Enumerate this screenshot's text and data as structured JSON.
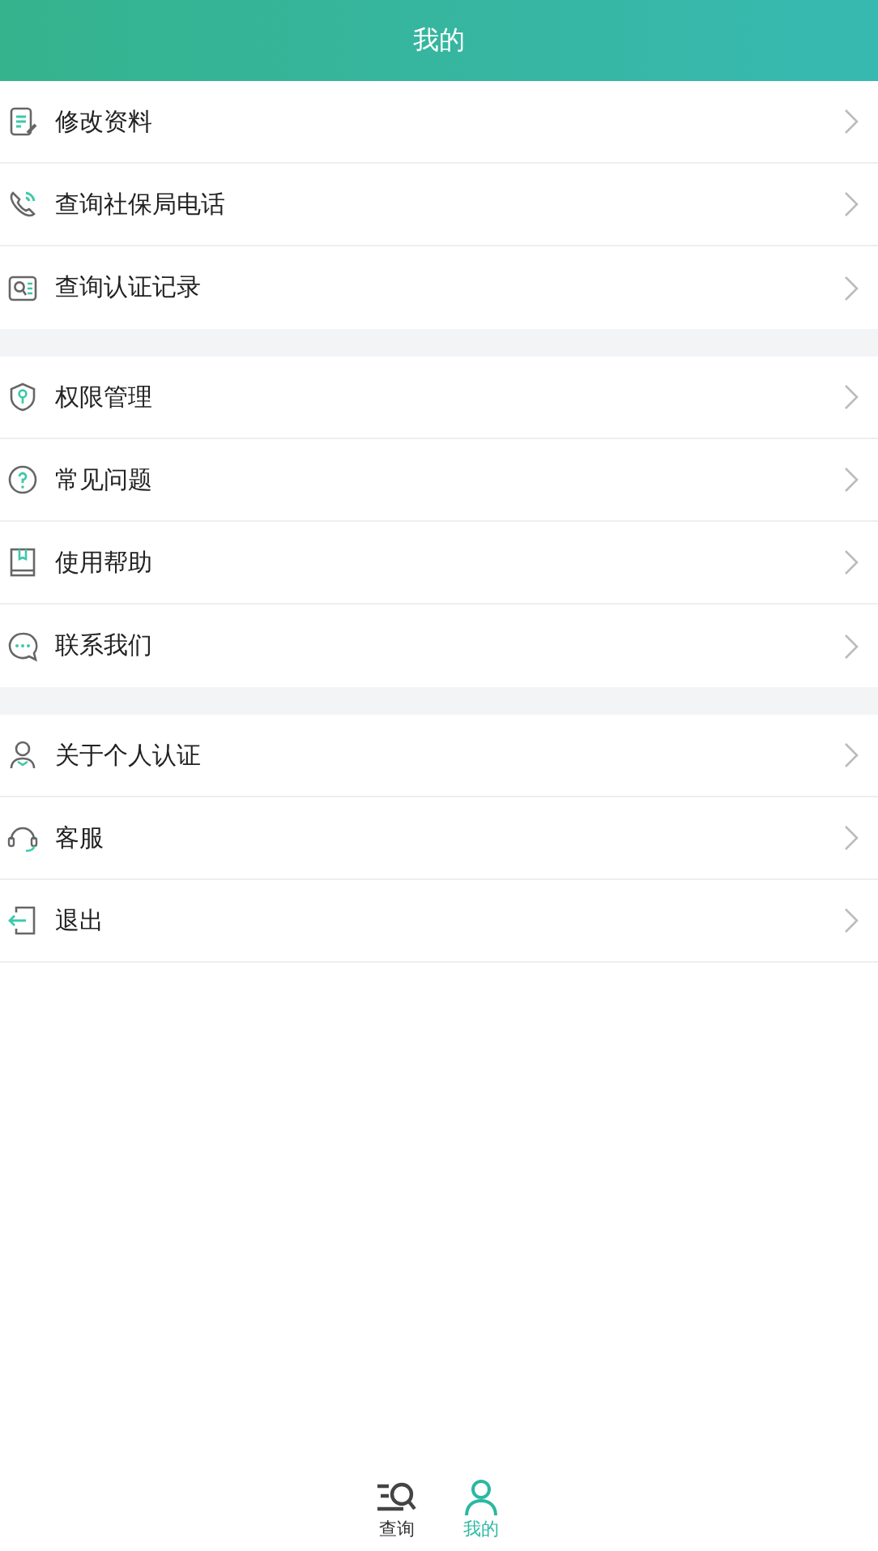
{
  "header": {
    "title": "我的"
  },
  "groups": [
    {
      "items": [
        {
          "label": "修改资料"
        },
        {
          "label": "查询社保局电话"
        },
        {
          "label": "查询认证记录"
        }
      ]
    },
    {
      "items": [
        {
          "label": "权限管理"
        },
        {
          "label": "常见问题"
        },
        {
          "label": "使用帮助"
        },
        {
          "label": "联系我们"
        }
      ]
    },
    {
      "items": [
        {
          "label": "关于个人认证"
        },
        {
          "label": "客服"
        },
        {
          "label": "退出"
        }
      ]
    }
  ],
  "tabs": [
    {
      "label": "查询",
      "selected": false
    },
    {
      "label": "我的",
      "selected": true
    }
  ]
}
